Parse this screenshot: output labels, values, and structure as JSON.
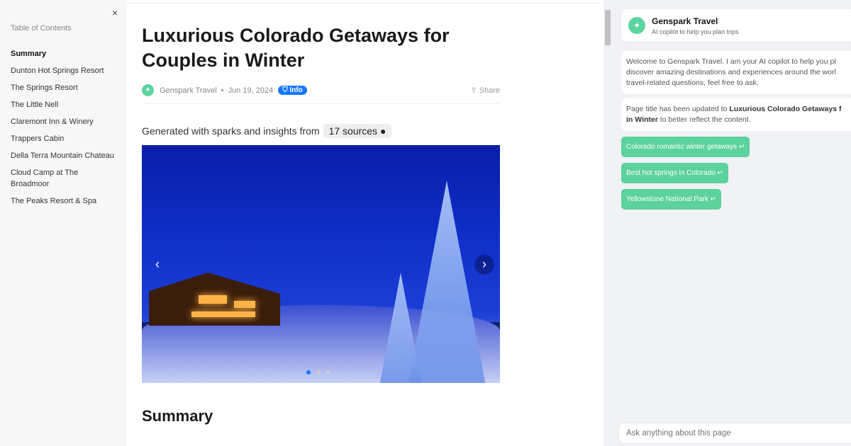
{
  "toc": {
    "heading": "Table of Contents",
    "close": "×",
    "items": [
      "Summary",
      "Dunton Hot Springs Resort",
      "The Springs Resort",
      "The Little Nell",
      "Claremont Inn & Winery",
      "Trappers Cabin",
      "Della Terra Mountain Chateau",
      "Cloud Camp at The Broadmoor",
      "The Peaks Resort & Spa"
    ]
  },
  "article": {
    "title": "Luxurious Colorado Getaways for Couples in Winter",
    "author": "Genspark Travel",
    "date": "Jun 19, 2024",
    "badge": "Info",
    "share": "Share",
    "generated": "Generated with sparks and insights from",
    "sources": "17 sources",
    "carousel": {
      "slides": 3,
      "active": 1,
      "prev": "‹",
      "next": "›"
    },
    "section": "Summary"
  },
  "copilot": {
    "title": "Genspark Travel",
    "subtitle": "AI copilot to help you plan trips",
    "welcome_lines": [
      "Welcome to Genspark Travel. I am your AI copilot to help you pl",
      "discover amazing destinations and experiences around the worl",
      "travel-related questions, feel free to ask."
    ],
    "update_pre": "Page title has been updated to ",
    "update_bold1": "Luxurious Colorado Getaways f",
    "update_bold2": "in Winter",
    "update_post": " to better reflect the content.",
    "suggestions": [
      "Colorado romantic winter getaways ↵",
      "Best hot springs in Colorado ↵",
      "Yellowstone National Park ↵"
    ],
    "placeholder": "Ask anything about this page"
  },
  "colors": {
    "accent": "#5cd29c",
    "info": "#1677ff"
  }
}
